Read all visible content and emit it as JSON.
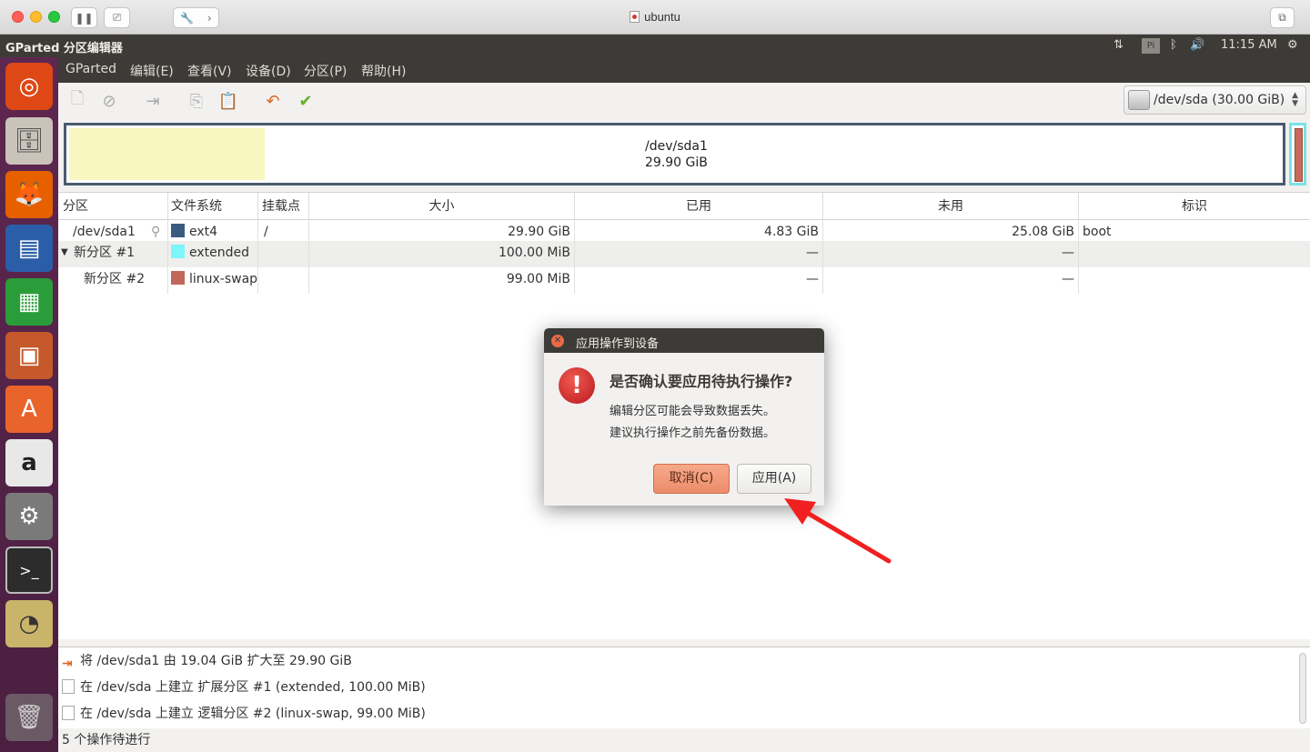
{
  "mac": {
    "window_title": "ubuntu"
  },
  "panel": {
    "app_title": "GParted 分区编辑器",
    "pi_label": "Pi",
    "time": "11:15 AM"
  },
  "menu": [
    "GParted",
    "编辑(E)",
    "查看(V)",
    "设备(D)",
    "分区(P)",
    "帮助(H)"
  ],
  "device": {
    "label": "/dev/sda   (30.00 GiB)"
  },
  "diskmap": {
    "partition": "/dev/sda1",
    "size": "29.90 GiB"
  },
  "table": {
    "headers": [
      "分区",
      "文件系统",
      "挂载点",
      "大小",
      "已用",
      "未用",
      "标识"
    ],
    "rows": [
      {
        "partition": "/dev/sda1",
        "fs": "ext4",
        "fs_color": "#3a5a80",
        "mount": "/",
        "size": "29.90 GiB",
        "used": "4.83 GiB",
        "unused": "25.08 GiB",
        "flags": "boot"
      },
      {
        "partition": "新分区 #1",
        "fs": "extended",
        "fs_color": "#7df5fa",
        "mount": "",
        "size": "100.00 MiB",
        "used": "—",
        "unused": "—",
        "flags": ""
      },
      {
        "partition": "新分区 #2",
        "fs": "linux-swap",
        "fs_color": "#c1665a",
        "mount": "",
        "size": "99.00 MiB",
        "used": "—",
        "unused": "—",
        "flags": ""
      }
    ]
  },
  "operations": [
    "将 /dev/sda1 由 19.04 GiB 扩大至 29.90 GiB",
    "在 /dev/sda 上建立 扩展分区 #1 (extended, 100.00 MiB)",
    "在 /dev/sda 上建立 逻辑分区 #2 (linux-swap, 99.00 MiB)"
  ],
  "status": "5 个操作待进行",
  "dialog": {
    "title": "应用操作到设备",
    "heading": "是否确认要应用待执行操作?",
    "line1": "编辑分区可能会导致数据丢失。",
    "line2": "建议执行操作之前先备份数据。",
    "cancel": "取消(C)",
    "apply": "应用(A)"
  },
  "colors": {
    "accent_cancel": "#ec8c6a",
    "arrow": "#f02020",
    "used_fill": "#f7f7bf"
  }
}
